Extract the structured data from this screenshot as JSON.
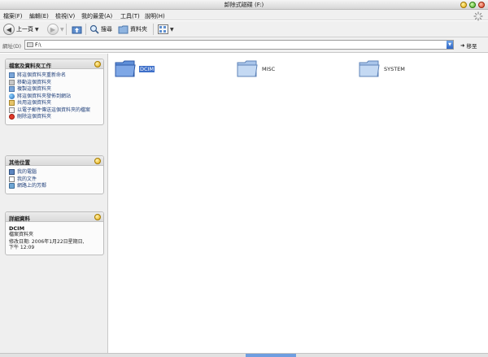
{
  "window": {
    "title": "卸除式磁碟 (F:)"
  },
  "menu": {
    "items": [
      "檔案(F)",
      "編輯(E)",
      "檢視(V)",
      "我的最愛(A)",
      "工具(T)",
      "說明(H)"
    ]
  },
  "toolbar": {
    "back_label": "上一頁",
    "search_label": "搜尋",
    "folders_label": "資料夾"
  },
  "address": {
    "label": "網址(D)",
    "value": "F:\\",
    "go_label": "移至"
  },
  "tasks_panel": {
    "title": "檔案及資料夾工作",
    "items": [
      "將這個資料夾重新命名",
      "移動這個資料夾",
      "複製這個資料夾",
      "將這個資料夾發佈到網站",
      "共用這個資料夾",
      "以電子郵件傳送這個資料夾的檔案",
      "刪除這個資料夾"
    ]
  },
  "places_panel": {
    "title": "其他位置",
    "items": [
      "我的電腦",
      "我的文件",
      "網路上的芳鄰"
    ]
  },
  "details_panel": {
    "title": "詳細資料",
    "name": "DCIM",
    "type": "檔案資料夾",
    "modified_line1": "修改日期: 2006年1月22日星期日,",
    "modified_line2": "下午 12:09"
  },
  "folders": [
    {
      "name": "DCIM",
      "selected": true
    },
    {
      "name": "MISC",
      "selected": false
    },
    {
      "name": "SYSTEM",
      "selected": false
    }
  ],
  "colors": {
    "selection": "#3d6fc9",
    "folder": "#8fb4e0"
  }
}
